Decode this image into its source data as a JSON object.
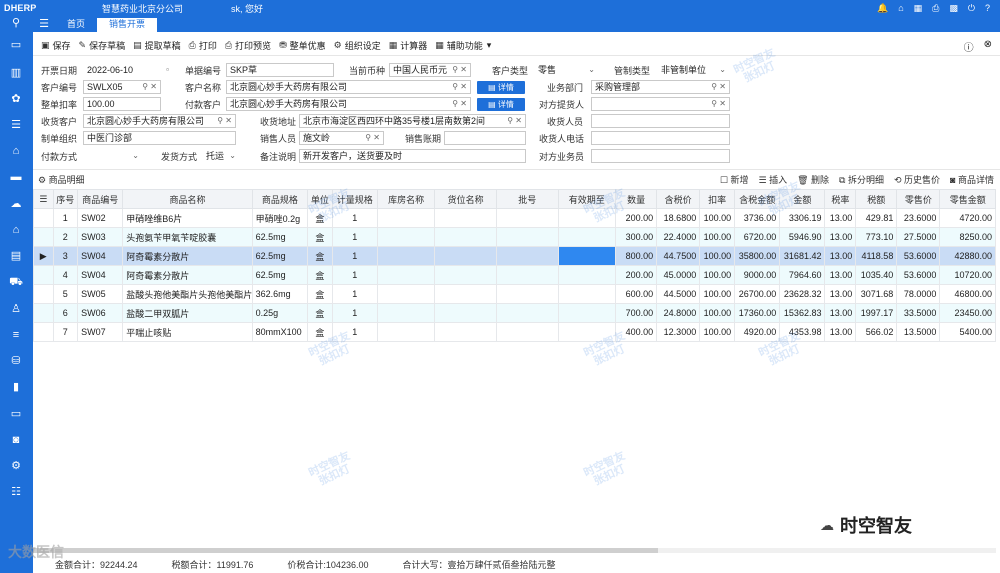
{
  "app": {
    "logo": "DHERP",
    "company": "智慧药业北京分公司",
    "user": "sk, 您好"
  },
  "tabs": [
    {
      "label": "首页"
    },
    {
      "label": "销售开票"
    }
  ],
  "toolbar": {
    "save": "保存",
    "save_draft": "保存草稿",
    "load_draft": "提取草稿",
    "print": "打印",
    "print_preview": "打印预览",
    "discount": "整单优惠",
    "org_settings": "组织设定",
    "calculator": "计算器",
    "aux": "辅助功能"
  },
  "form": {
    "invoice_date_label": "开票日期",
    "invoice_date": "2022-06-10",
    "doc_no_label": "单据编号",
    "doc_no": "SKP草",
    "currency_label": "当前币种",
    "currency": "中国人民币元",
    "customer_type_label": "客户类型",
    "customer_type": "零售",
    "control_type_label": "管制类型",
    "control_type": "非管制单位",
    "customer_code_label": "客户编号",
    "customer_code": "SWLX05",
    "customer_name_label": "客户名称",
    "customer_name": "北京圆心妙手大药房有限公司",
    "detail_btn": "详情",
    "biz_dept_label": "业务部门",
    "biz_dept": "采购管理部",
    "discount_rate_label": "整单扣率",
    "discount_rate": "100.00",
    "pay_customer_label": "付款客户",
    "pay_customer": "北京圆心妙手大药房有限公司",
    "counterpart_supplier_label": "对方提货人",
    "counterpart_supplier": "",
    "receiver_label": "收货客户",
    "receiver": "北京圆心妙手大药房有限公司",
    "receive_addr_label": "收货地址",
    "receive_addr": "北京市海淀区西四环中路35号楼1层南数第2间",
    "receive_person_label": "收货人员",
    "receive_person": "",
    "org_label": "制单组织",
    "org": "中医门诊部",
    "salesperson_label": "销售人员",
    "salesperson": "施文岭",
    "sales_account_label": "销售账期",
    "sales_account": "",
    "receiver_phone_label": "收货人电话",
    "receiver_phone": "",
    "pay_method_label": "付款方式",
    "pay_method": "",
    "ship_method_label": "发货方式",
    "ship_method": "托运",
    "remark_label": "备注说明",
    "remark": "新开发客户，送货要及时",
    "counterpart_biz_label": "对方业务员",
    "counterpart_biz": ""
  },
  "section": {
    "title": "商品明细",
    "add": "新增",
    "insert": "插入",
    "delete": "删除",
    "split": "拆分明细",
    "history": "历史售价",
    "goods_detail": "商品详情"
  },
  "table": {
    "headers": [
      "序号",
      "商品编号",
      "商品名称",
      "商品规格",
      "单位",
      "计量规格",
      "库房名称",
      "货位名称",
      "批号",
      "有效期至",
      "数量",
      "含税价",
      "扣率",
      "含税金额",
      "金额",
      "税率",
      "税额",
      "零售价",
      "零售金额"
    ],
    "rows": [
      {
        "no": "1",
        "code": "SW02",
        "name": "甲硝唑维B6片",
        "spec": "甲硝唑0.2g",
        "unit": "盒",
        "measure": "1",
        "qty": "200.00",
        "price": "18.6800",
        "rate": "100.00",
        "tax_amount": "3736.00",
        "amount": "3306.19",
        "tax_rate": "13.00",
        "tax": "429.81",
        "retail": "23.6000",
        "retail_amount": "4720.00"
      },
      {
        "no": "2",
        "code": "SW03",
        "name": "头孢氨苄甲氧苄啶胶囊",
        "spec": "62.5mg",
        "unit": "盒",
        "measure": "1",
        "qty": "300.00",
        "price": "22.4000",
        "rate": "100.00",
        "tax_amount": "6720.00",
        "amount": "5946.90",
        "tax_rate": "13.00",
        "tax": "773.10",
        "retail": "27.5000",
        "retail_amount": "8250.00"
      },
      {
        "no": "3",
        "code": "SW04",
        "name": "阿奇霉素分散片",
        "spec": "62.5mg",
        "unit": "盒",
        "measure": "1",
        "qty": "800.00",
        "price": "44.7500",
        "rate": "100.00",
        "tax_amount": "35800.00",
        "amount": "31681.42",
        "tax_rate": "13.00",
        "tax": "4118.58",
        "retail": "53.6000",
        "retail_amount": "42880.00"
      },
      {
        "no": "4",
        "code": "SW04",
        "name": "阿奇霉素分散片",
        "spec": "62.5mg",
        "unit": "盒",
        "measure": "1",
        "qty": "200.00",
        "price": "45.0000",
        "rate": "100.00",
        "tax_amount": "9000.00",
        "amount": "7964.60",
        "tax_rate": "13.00",
        "tax": "1035.40",
        "retail": "53.6000",
        "retail_amount": "10720.00"
      },
      {
        "no": "5",
        "code": "SW05",
        "name": "盐酸头孢他美酯片头孢他美酯片",
        "spec": "362.6mg",
        "unit": "盒",
        "measure": "1",
        "qty": "600.00",
        "price": "44.5000",
        "rate": "100.00",
        "tax_amount": "26700.00",
        "amount": "23628.32",
        "tax_rate": "13.00",
        "tax": "3071.68",
        "retail": "78.0000",
        "retail_amount": "46800.00"
      },
      {
        "no": "6",
        "code": "SW06",
        "name": "盐酸二甲双胍片",
        "spec": "0.25g",
        "unit": "盒",
        "measure": "1",
        "qty": "700.00",
        "price": "24.8000",
        "rate": "100.00",
        "tax_amount": "17360.00",
        "amount": "15362.83",
        "tax_rate": "13.00",
        "tax": "1997.17",
        "retail": "33.5000",
        "retail_amount": "23450.00"
      },
      {
        "no": "7",
        "code": "SW07",
        "name": "平喘止咳贴",
        "spec": "80mmX100",
        "unit": "盒",
        "measure": "1",
        "qty": "400.00",
        "price": "12.3000",
        "rate": "100.00",
        "tax_amount": "4920.00",
        "amount": "4353.98",
        "tax_rate": "13.00",
        "tax": "566.02",
        "retail": "13.5000",
        "retail_amount": "5400.00"
      }
    ]
  },
  "watermark": {
    "line1": "时空智友",
    "line2": "张扣灯"
  },
  "footer": {
    "amount_total": "金额合计：92244.24",
    "tax_total": "税额合计：11991.76",
    "price_tax_total": "价税合计:104236.00",
    "uppercase_total": "合计大写：壹拾万肆仟贰佰叁拾陆元整"
  },
  "brand": "时空智友",
  "corner_text": "大数医信"
}
